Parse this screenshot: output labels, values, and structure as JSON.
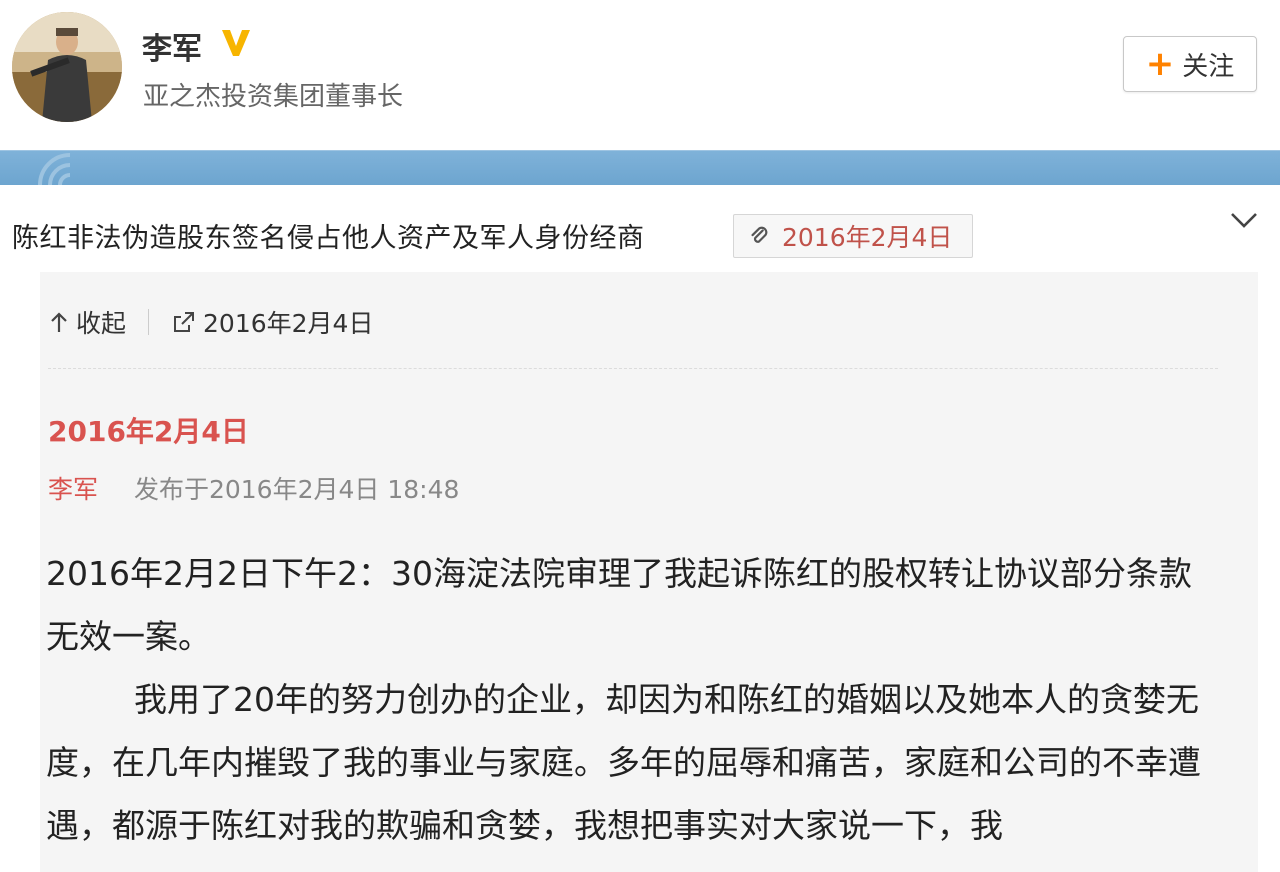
{
  "profile": {
    "name": "李军",
    "bio": "亚之杰投资集团董事长",
    "verified_icon": "verified-v-icon",
    "follow_label": "关注",
    "follow_icon": "plus-icon"
  },
  "article": {
    "title": "陈红非法伪造股东签名侵占他人资产及军人身份经商",
    "date_tag": "2016年2月4日",
    "collapse_icon": "chevron-down-icon"
  },
  "panel": {
    "collapse_label": "收起",
    "link_date": "2016年2月4日",
    "post_date": "2016年2月4日",
    "author": "李军",
    "published": "发布于2016年2月4日  18:48",
    "paragraphs": [
      "2016年2月2日下午2：30海淀法院审理了我起诉陈红的股权转让协议部分条款无效一案。",
      "我用了20年的努力创办的企业，却因为和陈红的婚姻以及她本人的贪婪无度，在几年内摧毁了我的事业与家庭。多年的屈辱和痛苦，家庭和公司的不幸遭遇，都源于陈红对我的欺骗和贪婪，我想把事实对大家说一下，我"
    ]
  },
  "colors": {
    "accent_red": "#d9534f",
    "banner_blue": "#7fb2d9",
    "follow_plus": "#ff8200",
    "verified_gold": "#f7b500"
  }
}
